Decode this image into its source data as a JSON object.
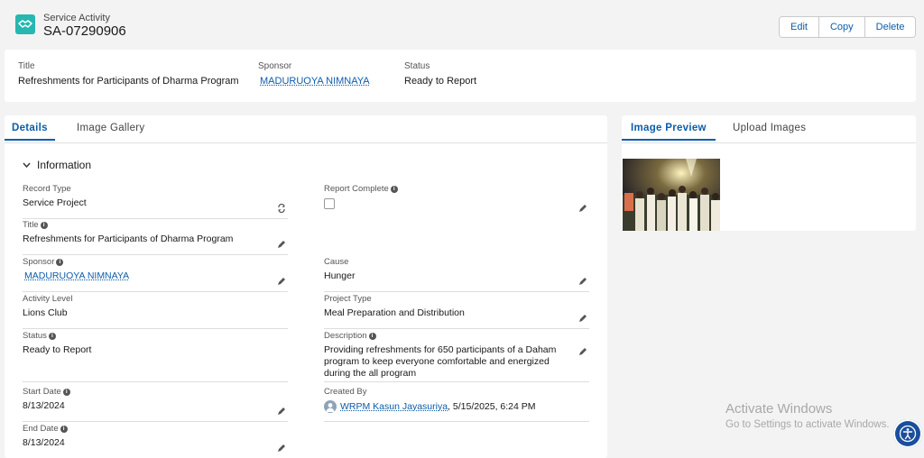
{
  "header": {
    "object_type": "Service Activity",
    "record_name": "SA-07290906",
    "icon": "handshake-icon",
    "buttons": {
      "edit": "Edit",
      "copy": "Copy",
      "delete": "Delete"
    }
  },
  "highlights": {
    "title_label": "Title",
    "title_value": "Refreshments for Participants of Dharma Program",
    "sponsor_label": "Sponsor",
    "sponsor_value": "MADURUOYA NIMNAYA",
    "status_label": "Status",
    "status_value": "Ready to Report"
  },
  "main_tabs": [
    "Details",
    "Image Gallery"
  ],
  "side_tabs": [
    "Image Preview",
    "Upload Images"
  ],
  "section": {
    "title": "Information"
  },
  "fields": {
    "record_type": {
      "label": "Record Type",
      "value": "Service Project"
    },
    "report_complete": {
      "label": "Report Complete",
      "checked": false
    },
    "title": {
      "label": "Title",
      "value": "Refreshments for Participants of Dharma Program"
    },
    "sponsor": {
      "label": "Sponsor",
      "value": "MADURUOYA NIMNAYA"
    },
    "cause": {
      "label": "Cause",
      "value": "Hunger"
    },
    "activity_level": {
      "label": "Activity Level",
      "value": "Lions Club"
    },
    "project_type": {
      "label": "Project Type",
      "value": "Meal Preparation and Distribution"
    },
    "status": {
      "label": "Status",
      "value": "Ready to Report"
    },
    "description": {
      "label": "Description",
      "value": "Providing refreshments for 650 participants of a Daham program to keep everyone comfortable and energized during the all program"
    },
    "start_date": {
      "label": "Start Date",
      "value": "8/13/2024"
    },
    "created_by": {
      "label": "Created By",
      "user": "WRPM Kasun Jayasuriya",
      "timestamp": ", 5/15/2025, 6:24 PM"
    },
    "end_date": {
      "label": "End Date",
      "value": "8/13/2024"
    }
  },
  "watermark": {
    "title": "Activate Windows",
    "subtitle": "Go to Settings to activate Windows."
  },
  "colors": {
    "brand_blue": "#0b5cab",
    "icon_teal": "#26b7b0",
    "accessibility_blue": "#1a4f9c"
  }
}
